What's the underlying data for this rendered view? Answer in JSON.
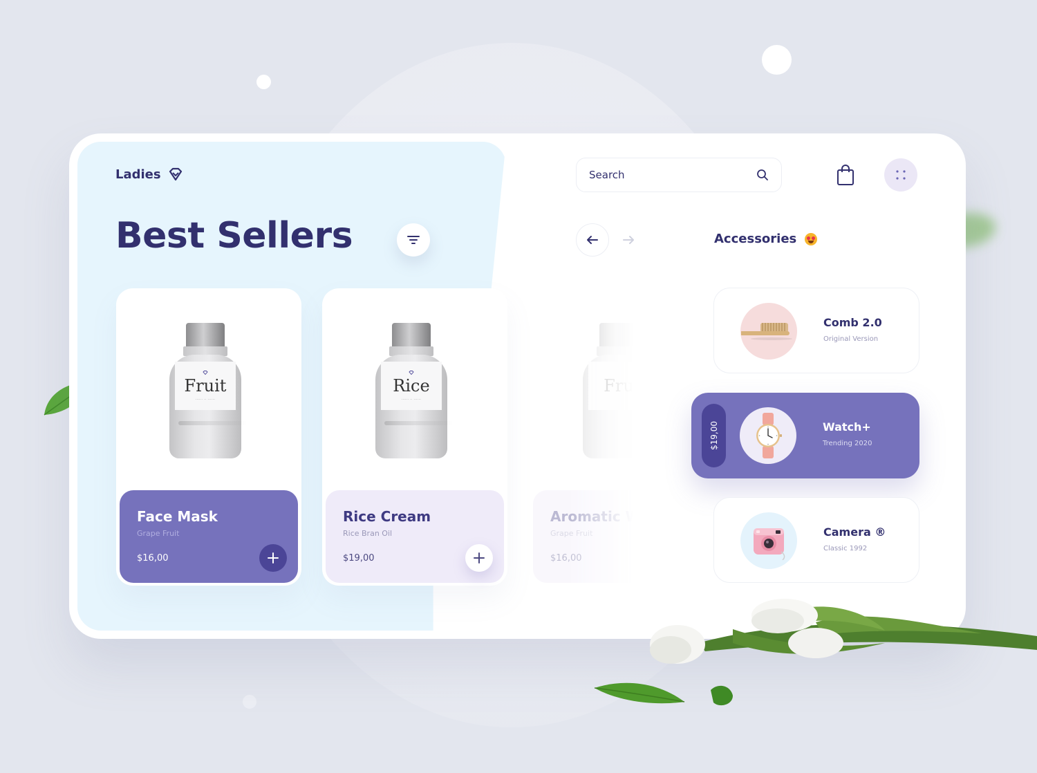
{
  "brand": {
    "name": "Ladies",
    "icon": "diamond-icon"
  },
  "page": {
    "title": "Best Sellers"
  },
  "search": {
    "placeholder": "Search"
  },
  "accessories": {
    "title": "Accessories",
    "emoji": "heart-eyes-emoji",
    "items": [
      {
        "name": "Comb 2.0",
        "subtitle": "Original Version",
        "image": "comb-image"
      },
      {
        "name": "Watch+",
        "subtitle": "Trending 2020",
        "price": "$19,00",
        "image": "watch-image",
        "active": true
      },
      {
        "name": "Camera ®",
        "subtitle": "Classic 1992",
        "image": "camera-image"
      }
    ]
  },
  "products": [
    {
      "name": "Face Mask",
      "subtitle": "Grape Fruit",
      "price": "$16,00",
      "label": "Fruit",
      "active": true
    },
    {
      "name": "Rice Cream",
      "subtitle": "Rice Bran Oil",
      "price": "$19,00",
      "label": "Rice"
    },
    {
      "name": "Aromatic W",
      "subtitle": "Grape Fruit",
      "price": "$16,00",
      "label": "Fru"
    }
  ],
  "colors": {
    "accent": "#7672bc",
    "accent_dark": "#4b4597",
    "text_dark": "#32306e",
    "panel_blue": "#e6f5fd",
    "background": "#e3e6ee"
  }
}
